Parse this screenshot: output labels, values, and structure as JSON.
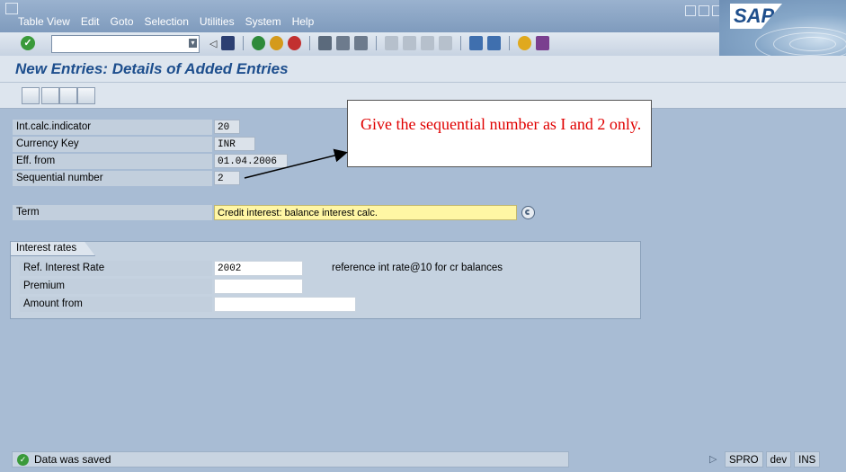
{
  "menu": {
    "items": [
      "Table View",
      "Edit",
      "Goto",
      "Selection",
      "Utilities",
      "System",
      "Help"
    ]
  },
  "brand": {
    "logo_text": "SAP"
  },
  "page": {
    "title": "New Entries: Details of Added Entries"
  },
  "fields": [
    {
      "label": "Int.calc.indicator",
      "value": "20"
    },
    {
      "label": "Currency Key",
      "value": "INR"
    },
    {
      "label": "Eff. from",
      "value": "01.04.2006"
    },
    {
      "label": "Sequential number",
      "value": "2"
    }
  ],
  "term": {
    "label": "Term",
    "value": "Credit interest: balance interest calc."
  },
  "interest_group": {
    "title": "Interest rates",
    "rows": [
      {
        "label": "Ref. Interest Rate",
        "value": "2002",
        "description": "reference int rate@10 for cr balances"
      },
      {
        "label": "Premium",
        "value": ""
      },
      {
        "label": "Amount from",
        "value": ""
      }
    ]
  },
  "annotation": {
    "text": "Give the sequential number as I and 2 only."
  },
  "status": {
    "message": "Data was saved",
    "transaction": "SPRO",
    "system": "dev",
    "mode": "INS"
  },
  "colors": {
    "title": "#1d4e8d",
    "annotation_text": "#e00000",
    "term_highlight": "#fff6a4"
  }
}
